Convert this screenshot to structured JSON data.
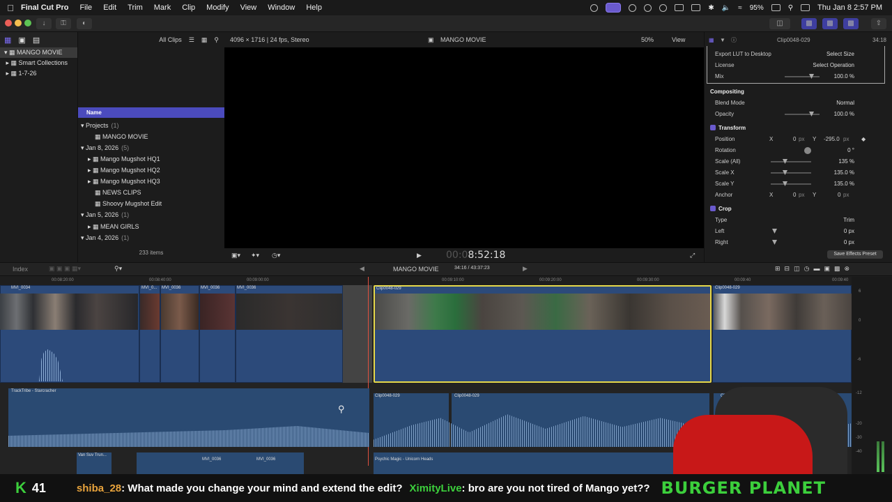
{
  "menubar": {
    "app_name": "Final Cut Pro",
    "items": [
      "File",
      "Edit",
      "Trim",
      "Mark",
      "Clip",
      "Modify",
      "View",
      "Window",
      "Help"
    ],
    "battery": "95%",
    "datetime": "Thu Jan 8  2:57 PM"
  },
  "library": {
    "items": [
      {
        "label": "MANGO MOVIE"
      },
      {
        "label": "Smart Collections"
      },
      {
        "label": "1-7-26"
      }
    ]
  },
  "browser": {
    "filter_label": "All Clips",
    "column_name": "Name",
    "rows": [
      {
        "label": "Projects",
        "count": "(1)"
      },
      {
        "label": "MANGO MOVIE",
        "count": ""
      },
      {
        "label": "Jan 8, 2026",
        "count": "(5)"
      },
      {
        "label": "Mango Mugshot HQ1",
        "count": ""
      },
      {
        "label": "Mango Mugshot HQ2",
        "count": ""
      },
      {
        "label": "Mango Mugshot HQ3",
        "count": ""
      },
      {
        "label": "NEWS CLIPS",
        "count": ""
      },
      {
        "label": "Shoovy Mugshot Edit",
        "count": ""
      },
      {
        "label": "Jan 5, 2026",
        "count": "(1)"
      },
      {
        "label": "MEAN GIRLS",
        "count": ""
      },
      {
        "label": "Jan 4, 2026",
        "count": "(1)"
      }
    ],
    "item_count": "233 items"
  },
  "viewer": {
    "format_info": "4096 × 1716 | 24 fps, Stereo",
    "project_title": "MANGO MOVIE",
    "zoom": "50%",
    "view_label": "View",
    "timecode_dim": "00:0",
    "timecode": "8:52:18"
  },
  "inspector": {
    "clip_name": "Clip0048-029",
    "clip_duration": "34:18",
    "rows": {
      "export_lut": {
        "label": "Export LUT to Desktop",
        "value": "Select Size"
      },
      "license": {
        "label": "License",
        "value": "Select Operation"
      },
      "mix": {
        "label": "Mix",
        "value": "100.0 %"
      },
      "compositing": "Compositing",
      "blend_mode": {
        "label": "Blend Mode",
        "value": "Normal"
      },
      "opacity": {
        "label": "Opacity",
        "value": "100.0 %"
      },
      "transform": "Transform",
      "position": {
        "label": "Position",
        "x_label": "X",
        "x": "0",
        "x_unit": "px",
        "y_label": "Y",
        "y": "-295.0",
        "y_unit": "px"
      },
      "rotation": {
        "label": "Rotation",
        "value": "0 °"
      },
      "scale_all": {
        "label": "Scale (All)",
        "value": "135 %"
      },
      "scale_x": {
        "label": "Scale X",
        "value": "135.0 %"
      },
      "scale_y": {
        "label": "Scale Y",
        "value": "135.0 %"
      },
      "anchor": {
        "label": "Anchor",
        "x_label": "X",
        "x": "0",
        "x_unit": "px",
        "y_label": "Y",
        "y": "0",
        "y_unit": "px"
      },
      "crop": "Crop",
      "type": {
        "label": "Type",
        "value": "Trim"
      },
      "left": {
        "label": "Left",
        "value": "0 px"
      },
      "right": {
        "label": "Right",
        "value": "0 px"
      }
    },
    "save_preset": "Save Effects Preset"
  },
  "timeline": {
    "index_label": "Index",
    "project": "MANGO MOVIE",
    "duration": "34:16 / 43:37:23",
    "ruler": [
      "00:08:20:00",
      "00:08:40:00",
      "00:09:00:00",
      "00:09:10:00",
      "00:09:20:00",
      "00:09:30:00",
      "00:09:40"
    ],
    "clips": {
      "c1": "MVI_0034",
      "c2": "MVI_0...",
      "c3": "MVI_0036",
      "c4": "MVI_0036",
      "c5": "MVI_0036",
      "selected": "Clip0048-029",
      "after": "Clip0048-029"
    },
    "audio": {
      "music": "TrackTribe - Starcracher",
      "a1": "Clip0048-029",
      "a2": "Clip0048-029",
      "a3": "Clip...",
      "small1": "Van Suv Trun...",
      "small2": "MVI_0036",
      "small3": "MVI_0036",
      "psychic": "Psychic Magic - Unicorn Heads"
    }
  },
  "meters": [
    "6",
    "0",
    "-6",
    "-12",
    "-20",
    "-30",
    "-40"
  ],
  "chat": {
    "logo_letter": "K",
    "viewer_count": "41",
    "msg1_user": "shiba_28",
    "msg1_text": ": What made you change your mind and extend the edit?",
    "msg2_user": "XimityLive",
    "msg2_text": ": bro are you not tired of Mango yet??",
    "brand": "BURGER PLANET"
  },
  "colors": {
    "accent": "#6a5acd",
    "selection_yellow": "#e6d84a",
    "clip_blue": "#2c4a7a",
    "audio_blue": "#2a4a72",
    "chat_green": "#3ccf3c",
    "chat_user": "#e8a33c"
  }
}
